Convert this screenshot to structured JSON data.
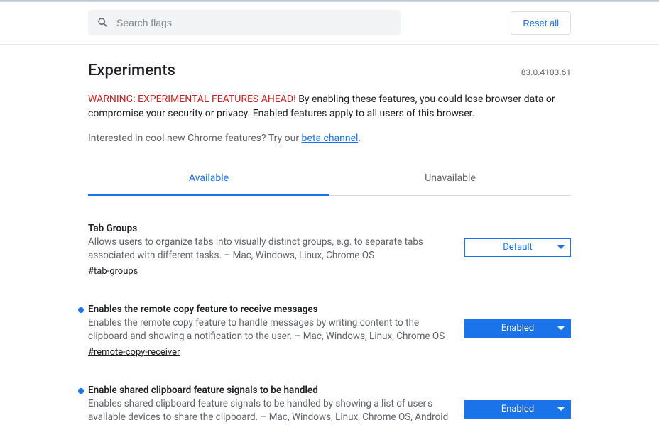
{
  "search": {
    "placeholder": "Search flags"
  },
  "reset_label": "Reset all",
  "page_title": "Experiments",
  "version": "83.0.4103.61",
  "warning": {
    "red": "WARNING: EXPERIMENTAL FEATURES AHEAD!",
    "rest": " By enabling these features, you could lose browser data or compromise your security or privacy. Enabled features apply to all users of this browser."
  },
  "interest": {
    "prefix": "Interested in cool new Chrome features? Try our ",
    "link": "beta channel",
    "suffix": "."
  },
  "tabs": {
    "available": "Available",
    "unavailable": "Unavailable"
  },
  "flags": [
    {
      "title": "Tab Groups",
      "desc": "Allows users to organize tabs into visually distinct groups, e.g. to separate tabs associated with different tasks. – Mac, Windows, Linux, Chrome OS",
      "hash": "#tab-groups",
      "value": "Default",
      "enabled": false,
      "indicator": false
    },
    {
      "title": "Enables the remote copy feature to receive messages",
      "desc": "Enables the remote copy feature to handle messages by writing content to the clipboard and showing a notification to the user. – Mac, Windows, Linux, Chrome OS",
      "hash": "#remote-copy-receiver",
      "value": "Enabled",
      "enabled": true,
      "indicator": true
    },
    {
      "title": "Enable shared clipboard feature signals to be handled",
      "desc": "Enables shared clipboard feature signals to be handled by showing a list of user's available devices to share the clipboard. – Mac, Windows, Linux, Chrome OS, Android",
      "hash": "",
      "value": "Enabled",
      "enabled": true,
      "indicator": true
    }
  ]
}
